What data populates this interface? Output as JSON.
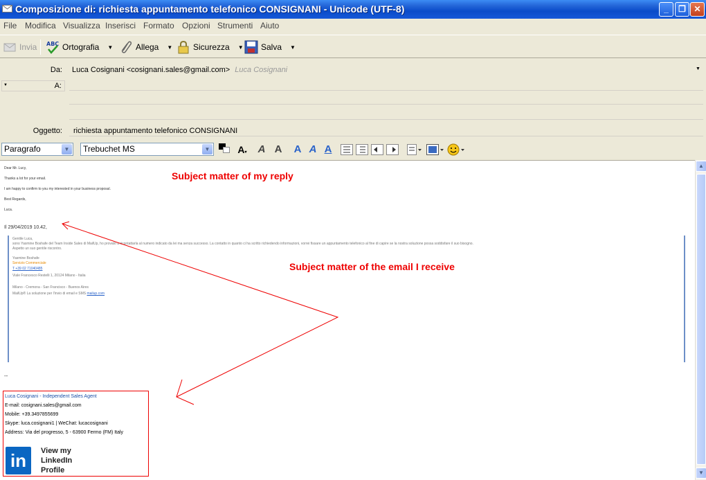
{
  "window": {
    "title": "Composizione di: richiesta appuntamento telefonico CONSIGNANI - Unicode (UTF-8)"
  },
  "menu": [
    "File",
    "Modifica",
    "Visualizza",
    "Inserisci",
    "Formato",
    "Opzioni",
    "Strumenti",
    "Aiuto"
  ],
  "toolbar": {
    "send": "Invia",
    "spell": "Ortografia",
    "attach": "Allega",
    "security": "Sicurezza",
    "save": "Salva"
  },
  "headers": {
    "from_label": "Da:",
    "from_value": "Luca Cosignani <cosignani.sales@gmail.com>",
    "from_identity": "Luca Cosignani",
    "to_label": "A:",
    "to_value": "",
    "subject_label": "Oggetto:",
    "subject_value": "richiesta appuntamento telefonico CONSIGNANI"
  },
  "format": {
    "paragraph": "Paragrafo",
    "font": "Trebuchet MS"
  },
  "reply": {
    "greeting": "Dear Mr. Lucy,",
    "line1": "Thanks a lot for your email.",
    "line2": "I am happy to confirm to you my interested in your business proposal.",
    "closing": "Best Regards,",
    "name": "Luca."
  },
  "quote": {
    "header": "Il 29/04/2019 10.42,",
    "greeting": "Gentile Luca,",
    "body": "sono Yasmine Boshafe del Team Inside Sales di MailUp, ho provato a ricontattarla al numero indicato da lei ma senza successo. La contatto in quanto ci ha scritto richiedendo informazioni, vorrei fissare un appuntamento telefonico al fine di capire se la nostra soluzione possa soddisfare il suo bisogno.",
    "wait": "Aspetto un suo gentile riscontro.",
    "sender_name": "Yasmine Boshafe",
    "sender_role": "Servizio Commerciale",
    "sender_phone": "T +39 02 71040485",
    "address": "Viale Francesco Restelli 1, 20124 Milano - Italia",
    "cities": "Milano - Cremona - San Francisco - Buenos Aires",
    "tagline_prefix": "MailUp® La soluzione per l'invio di email e SMS",
    "tagline_link": "mailup.com"
  },
  "annotations": {
    "reply_label": "Subject matter of my reply",
    "received_label": "Subject matter of the email I receive"
  },
  "signature": {
    "dash": "--",
    "title": "Luca Cosignani - Independent Sales Agent",
    "email": "E-mail: cosignani.sales@gmail.com",
    "mobile": "Mobile: +39.3497855699",
    "skype_wechat": "Skype: luca.cosignani1  |  WeChat: lucacosignani",
    "address": "Address: Via del progresso, 5 - 63900 Fermo (FM) Italy",
    "linkedin_logo": "in",
    "linkedin_line1": "View my",
    "linkedin_line2": "LinkedIn",
    "linkedin_line3": "Profile"
  },
  "colors": {
    "accent": "#0a4bc9",
    "annotation": "#e00000",
    "quote_bar": "#6d8fc7"
  }
}
